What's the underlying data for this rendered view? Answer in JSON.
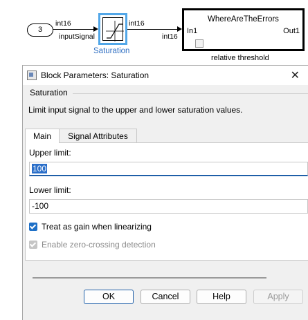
{
  "model": {
    "constant_value": "3",
    "const_signal_type": "int16",
    "input_signal_label": "inputSignal",
    "sat_out_type": "int16",
    "sat_block_name": "Saturation",
    "sub_in_type": "int16",
    "subsystem_title": "WhereAreTheErrors",
    "subsystem_in_port": "In1",
    "subsystem_out_port": "Out1",
    "subsystem_caption": "relative threshold",
    "colors": {
      "selection": "#52a7e8",
      "block_name": "#2f6fc2"
    }
  },
  "dialog": {
    "title": "Block Parameters: Saturation",
    "group_label": "Saturation",
    "description": "Limit input signal to the upper and lower saturation values.",
    "tabs": [
      {
        "label": "Main",
        "active": true
      },
      {
        "label": "Signal Attributes",
        "active": false
      }
    ],
    "upper_limit": {
      "label": "Upper limit:",
      "value": "100"
    },
    "lower_limit": {
      "label": "Lower limit:",
      "value": "-100"
    },
    "treat_as_gain": {
      "label": "Treat as gain when linearizing",
      "checked": true
    },
    "zero_crossing": {
      "label": "Enable zero-crossing detection",
      "checked": true,
      "disabled": true
    },
    "buttons": {
      "ok": "OK",
      "cancel": "Cancel",
      "help": "Help",
      "apply": "Apply"
    },
    "colors": {
      "accent": "#1d6fc7",
      "focus_border": "#1f5fa8"
    }
  }
}
